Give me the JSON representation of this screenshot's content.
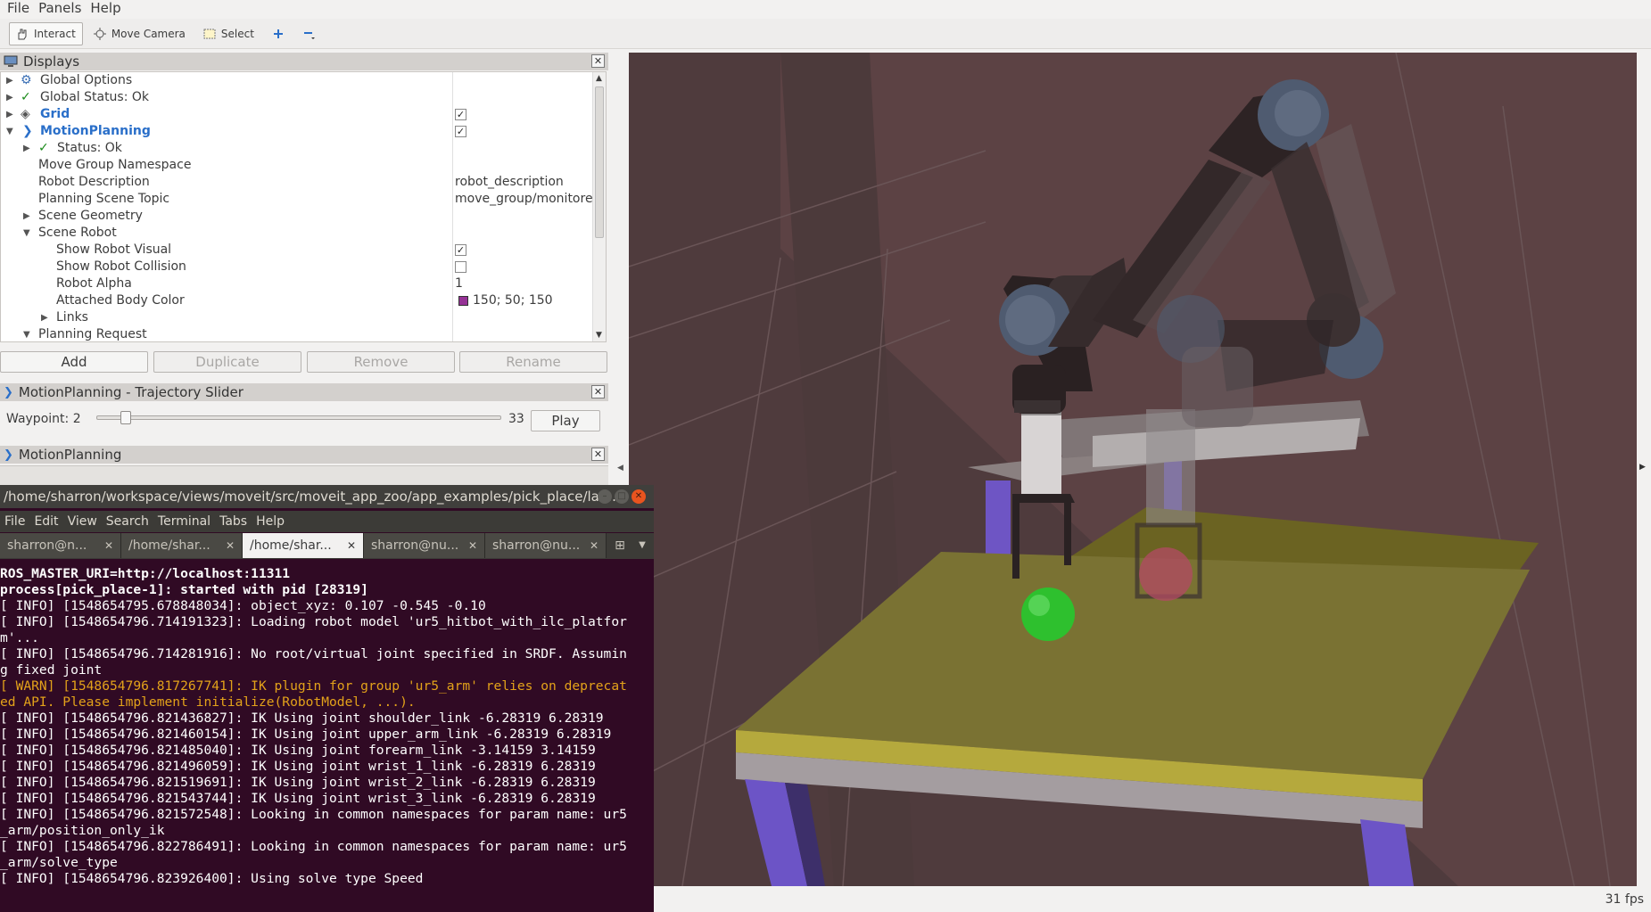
{
  "menubar": {
    "file": "File",
    "panels": "Panels",
    "help": "Help"
  },
  "toolbar": {
    "interact": "Interact",
    "move_camera": "Move Camera",
    "select": "Select"
  },
  "displays": {
    "title": "Displays",
    "rows": {
      "global_options": "Global Options",
      "global_status": "Global Status: Ok",
      "grid": "Grid",
      "motion_planning": "MotionPlanning",
      "status": "Status: Ok",
      "move_group_ns": "Move Group Namespace",
      "robot_description": "Robot Description",
      "robot_description_val": "robot_description",
      "planning_scene_topic": "Planning Scene Topic",
      "planning_scene_topic_val": "move_group/monitore...",
      "scene_geometry": "Scene Geometry",
      "scene_robot": "Scene Robot",
      "show_robot_visual": "Show Robot Visual",
      "show_robot_collision": "Show Robot Collision",
      "robot_alpha": "Robot Alpha",
      "robot_alpha_val": "1",
      "attached_body_color": "Attached Body Color",
      "attached_body_color_val": "150; 50; 150",
      "links": "Links",
      "planning_request": "Planning Request"
    },
    "buttons": {
      "add": "Add",
      "duplicate": "Duplicate",
      "remove": "Remove",
      "rename": "Rename"
    }
  },
  "traj_slider": {
    "title": "MotionPlanning - Trajectory Slider",
    "waypoint_label": "Waypoint:",
    "waypoint": "2",
    "max": "33",
    "play": "Play",
    "position": 0.06
  },
  "motion_planning_panel": {
    "title": "MotionPlanning"
  },
  "terminal": {
    "title": "/home/sharron/workspace/views/moveit/src/moveit_app_zoo/app_examples/pick_place/lau...",
    "menu": [
      "File",
      "Edit",
      "View",
      "Search",
      "Terminal",
      "Tabs",
      "Help"
    ],
    "tabs": [
      "sharron@n...",
      "/home/shar...",
      "/home/shar...",
      "sharron@nu...",
      "sharron@nu..."
    ],
    "lines": [
      "ROS_MASTER_URI=http://localhost:11311",
      "",
      "process[pick_place-1]: started with pid [28319]",
      "[ INFO] [1548654795.678848034]: object_xyz: 0.107 -0.545 -0.10",
      "[ INFO] [1548654796.714191323]: Loading robot model 'ur5_hitbot_with_ilc_platfor",
      "m'...",
      "[ INFO] [1548654796.714281916]: No root/virtual joint specified in SRDF. Assumin",
      "g fixed joint",
      "[ WARN] [1548654796.817267741]: IK plugin for group 'ur5_arm' relies on deprecat",
      "ed API. Please implement initialize(RobotModel, ...).",
      "[ INFO] [1548654796.821436827]: IK Using joint shoulder_link -6.28319 6.28319",
      "[ INFO] [1548654796.821460154]: IK Using joint upper_arm_link -6.28319 6.28319",
      "[ INFO] [1548654796.821485040]: IK Using joint forearm_link -3.14159 3.14159",
      "[ INFO] [1548654796.821496059]: IK Using joint wrist_1_link -6.28319 6.28319",
      "[ INFO] [1548654796.821519691]: IK Using joint wrist_2_link -6.28319 6.28319",
      "[ INFO] [1548654796.821543744]: IK Using joint wrist_3_link -6.28319 6.28319",
      "[ INFO] [1548654796.821572548]: Looking in common namespaces for param name: ur5",
      "_arm/position_only_ik",
      "[ INFO] [1548654796.822786491]: Looking in common namespaces for param name: ur5",
      "_arm/solve_type",
      "[ INFO] [1548654796.823926400]: Using solve type Speed"
    ]
  },
  "status": {
    "fps": "31 fps"
  },
  "colors": {
    "attached_body": "#963296",
    "rviz_blue": "#2a6fc9"
  }
}
